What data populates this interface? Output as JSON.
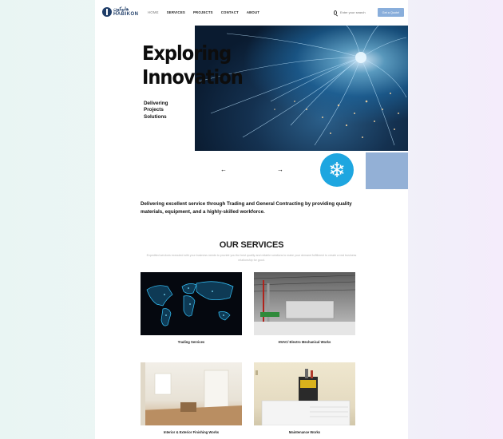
{
  "header": {
    "logo_arabic": "هابيكون",
    "logo_text": "HABIKON",
    "nav": [
      "HOME",
      "SERVICES",
      "PROJECTS",
      "CONTACT",
      "ABOUT"
    ],
    "search_placeholder": "Enter your search",
    "quote_button": "Get a Quote!"
  },
  "hero": {
    "title_line1": "Exploring",
    "title_line2": "Innovation",
    "sub_line1": "Delivering",
    "sub_line2": "Projects",
    "sub_line3": "Solutions",
    "prev_arrow": "←",
    "next_arrow": "→"
  },
  "intro": {
    "text": "Delivering excellent service through Trading and General Contracting by providing quality materials, equipment, and a highly-skilled workforce."
  },
  "services": {
    "title": "OUR SERVICES",
    "subtitle": "Expedited services executed with your business needs to provide you the best quality and reliable solutions to make your demand fulfillment to create a real business relationship for good.",
    "items": [
      {
        "label": "Trading Services"
      },
      {
        "label": "HVAC/ Electro Mechanical Works"
      },
      {
        "label": "Interior & Exterior Finishing Works"
      },
      {
        "label": "Maintenance Works"
      }
    ]
  },
  "colors": {
    "accent": "#89aedb",
    "brand": "#1f3d68",
    "snow_badge": "#1ea6e0"
  }
}
